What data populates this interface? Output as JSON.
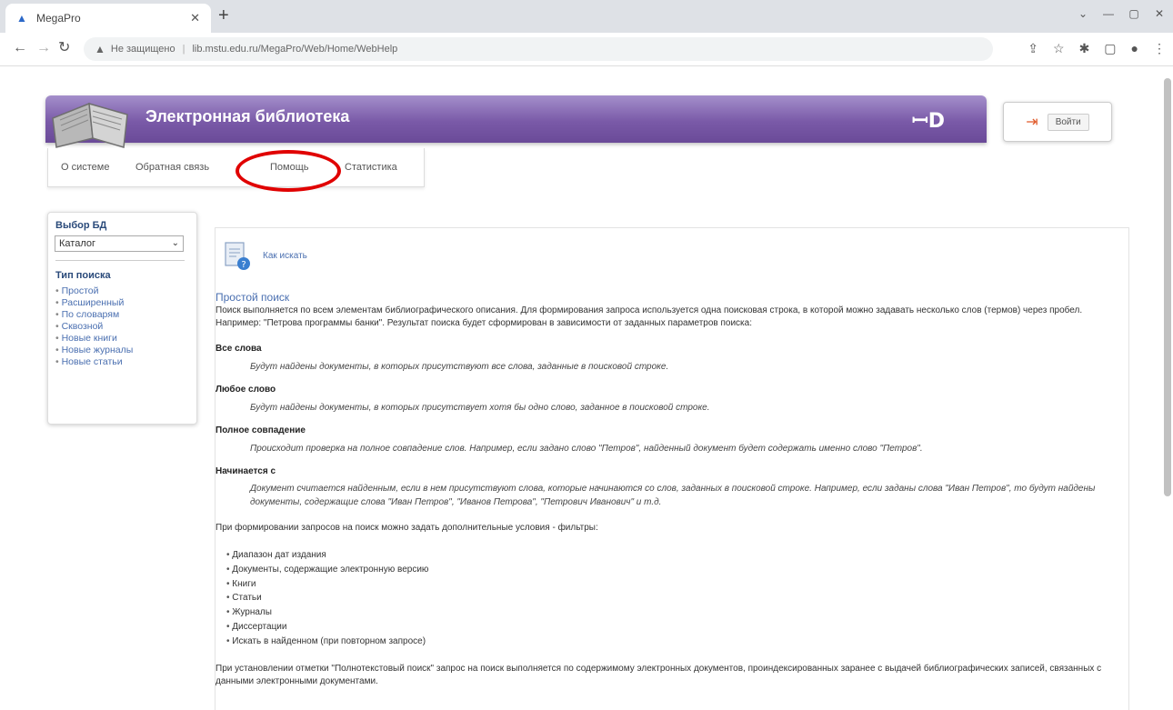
{
  "browser": {
    "tab_title": "MegaPro",
    "url_warning": "Не защищено",
    "url": "lib.mstu.edu.ru/MegaPro/Web/Home/WebHelp"
  },
  "header": {
    "title": "Электронная библиотека",
    "logo_glyph": "ꟷD",
    "login_label": "Войти"
  },
  "nav": {
    "items": [
      "О системе",
      "Обратная связь",
      "Помощь",
      "Статистика"
    ],
    "highlighted": "Помощь",
    "highlight_color": "#e00000"
  },
  "sidebar": {
    "db_heading": "Выбор БД",
    "db_selected": "Каталог",
    "search_type_heading": "Тип поиска",
    "items": [
      "Простой",
      "Расширенный",
      "По словарям",
      "Сквозной",
      "Новые книги",
      "Новые журналы",
      "Новые статьи"
    ]
  },
  "content": {
    "help_link": "Как искать",
    "section_title": "Простой поиск",
    "intro": "Поиск выполняется по всем элементам библиографического описания. Для формирования запроса используется одна поисковая строка, в которой можно задавать несколько слов (термов) через пробел. Например: \"Петрова программы банки\". Результат поиска будет сформирован в зависимости от заданных параметров поиска:",
    "terms": [
      {
        "title": "Все слова",
        "desc": "Будут найдены документы, в которых присутствуют все слова, заданные в поисковой строке."
      },
      {
        "title": "Любое слово",
        "desc": "Будут найдены документы, в которых присутствует хотя бы одно слово, заданное в поисковой строке."
      },
      {
        "title": "Полное совпадение",
        "desc": "Происходит проверка на полное совпадение слов. Например, если задано слово \"Петров\", найденный документ будет содержать именно слово \"Петров\"."
      },
      {
        "title": "Начинается с",
        "desc": "Документ считается найденным, если в нем присутствуют слова, которые начинаются со слов, заданных в поисковой строке. Например, если заданы слова \"Иван Петров\", то будут найдены документы, содержащие слова \"Иван Петров\", \"Иванов Петрова\", \"Петрович Иванович\" и т.д."
      }
    ],
    "filters_intro": "При формировании запросов на поиск можно задать дополнительные условия - фильтры:",
    "filters": [
      "Диапазон дат издания",
      "Документы, содержащие электронную версию",
      "Книги",
      "Статьи",
      "Журналы",
      "Диссертации",
      "Искать в найденном (при повторном запросе)"
    ],
    "fulltext_note": "При установлении отметки \"Полнотекстовый поиск\" запрос на поиск выполняется по содержимому электронных документов, проиндексированных заранее с выдачей библиографических записей, связанных с данными электронными документами."
  },
  "colors": {
    "banner_purple": "#7a5aa8",
    "link_blue": "#4a6fb0"
  }
}
